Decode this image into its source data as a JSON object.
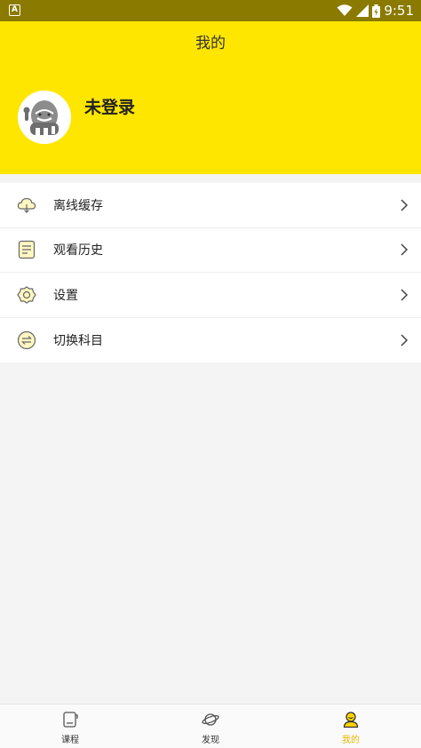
{
  "status_bar": {
    "notification_icon": "A",
    "time": "9:51",
    "icons": [
      "wifi-icon",
      "signal-icon",
      "battery-icon"
    ]
  },
  "header": {
    "title": "我的"
  },
  "profile": {
    "username": "未登录",
    "avatar_icon": "mascot-avatar-icon"
  },
  "menu": {
    "items": [
      {
        "label": "离线缓存",
        "icon": "cloud-download-icon"
      },
      {
        "label": "观看历史",
        "icon": "history-document-icon"
      },
      {
        "label": "设置",
        "icon": "settings-icon"
      },
      {
        "label": "切换科目",
        "icon": "switch-icon"
      }
    ]
  },
  "tabbar": {
    "tabs": [
      {
        "label": "课程",
        "icon": "course-book-icon",
        "active": false
      },
      {
        "label": "发现",
        "icon": "planet-icon",
        "active": false
      },
      {
        "label": "我的",
        "icon": "user-icon",
        "active": true
      }
    ]
  },
  "colors": {
    "accent": "#ffe600",
    "status_bar": "#8a7a00",
    "active_tab": "#e6b800"
  }
}
